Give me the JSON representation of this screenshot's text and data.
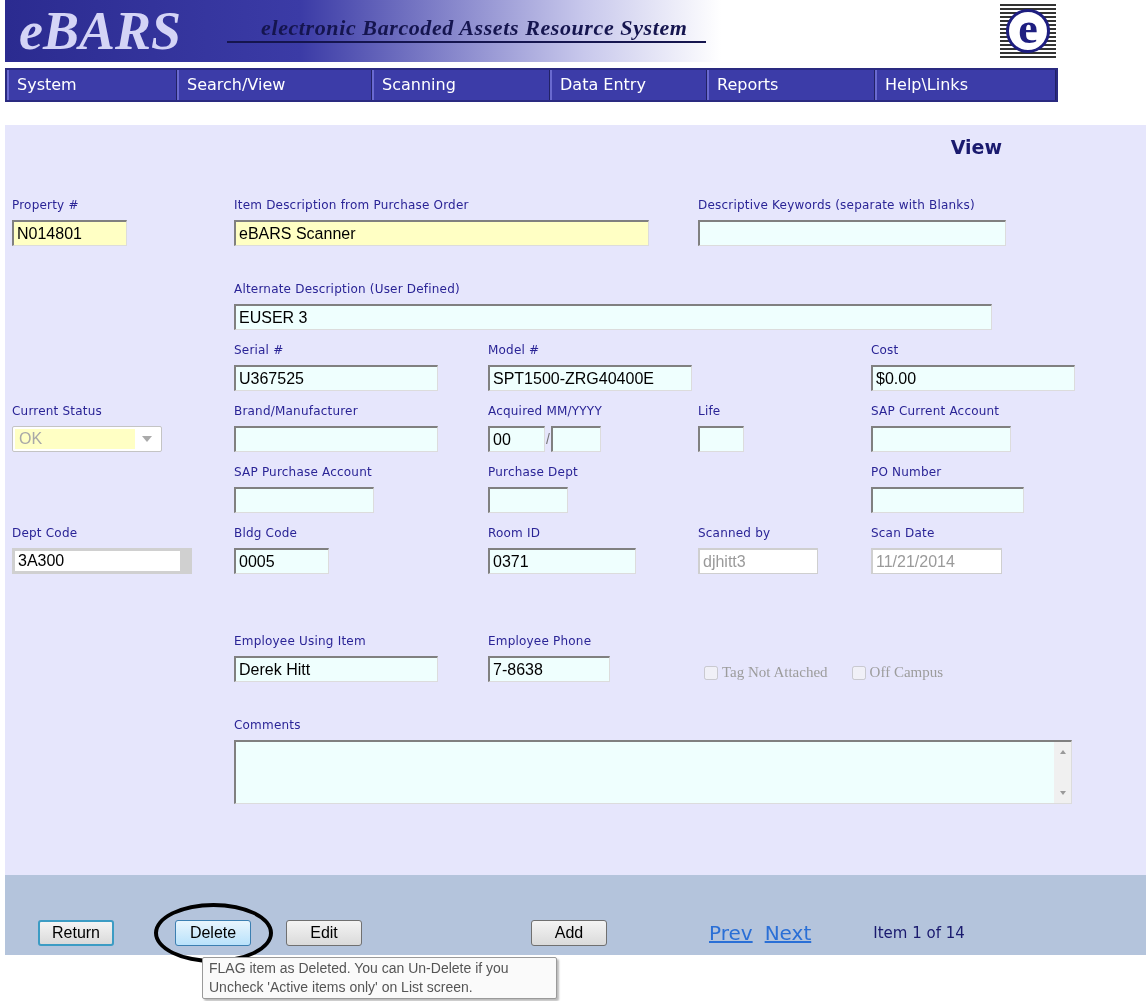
{
  "header": {
    "logo": "eBARS",
    "tagline": "electronic Barcoded Assets Resource System",
    "emblem": "e"
  },
  "nav": [
    {
      "label": "System"
    },
    {
      "label": "Search/View"
    },
    {
      "label": "Scanning"
    },
    {
      "label": "Data Entry"
    },
    {
      "label": "Reports"
    },
    {
      "label": "Help\\Links"
    }
  ],
  "page_title": "View",
  "form_rows": [
    [
      {
        "kind": "text",
        "label": "Property #",
        "value": "N014801",
        "color": "#ffffc4"
      },
      {
        "kind": "text",
        "label": "Item Description from Purchase Order",
        "value": "eBARS Scanner",
        "color": "#ffffc4"
      },
      null,
      {
        "kind": "text",
        "label": "Descriptive Keywords (separate with Blanks)",
        "color": "#effffe"
      },
      null
    ],
    [
      null,
      {
        "kind": "text",
        "label": "Alternate Description (User Defined)",
        "value": "EUSER 3",
        "color": "#effffe"
      },
      null,
      null,
      null
    ],
    [
      null,
      {
        "kind": "text",
        "label": "Serial #",
        "value": "U367525",
        "color": "#effffe"
      },
      {
        "kind": "text",
        "label": "Model #",
        "value": "SPT1500-ZRG40400E",
        "color": "#effffe"
      },
      null,
      {
        "kind": "text",
        "label": "Cost",
        "value": "$0.00",
        "color": "#effffe"
      }
    ],
    [
      {
        "kind": "select",
        "label": "Current Status",
        "value": "OK",
        "color": "#ffffc4",
        "disabled": true
      },
      {
        "kind": "text",
        "label": "Brand/Manufacturer",
        "color": "#effffe"
      },
      {
        "kind": "date",
        "label": "Acquired MM/YYYY",
        "month": "00",
        "separator": "/",
        "color": "#effffe"
      },
      {
        "kind": "text",
        "label": "Life",
        "color": "#effffe"
      },
      {
        "kind": "text",
        "label": "SAP Current Account",
        "color": "#effffe"
      }
    ],
    [
      null,
      {
        "kind": "text",
        "label": "SAP Purchase Account",
        "color": "#effffe"
      },
      {
        "kind": "text",
        "label": "Purchase Dept",
        "color": "#effffe"
      },
      null,
      {
        "kind": "text",
        "label": "PO Number",
        "color": "#effffe"
      }
    ],
    [
      {
        "kind": "text",
        "label": "Dept Code",
        "value": "3A300",
        "color": "#ffffff"
      },
      {
        "kind": "text",
        "label": "Bldg Code",
        "value": "0005",
        "color": "#effffe"
      },
      {
        "kind": "text",
        "label": "Room ID",
        "value": "0371",
        "color": "#effffe"
      },
      {
        "kind": "text",
        "label": "Scanned by",
        "value": "djhitt3",
        "color": "#ffffff",
        "disabled": true
      },
      {
        "kind": "text",
        "label": "Scan Date",
        "value": "11/21/2014",
        "color": "#ffffff",
        "disabled": true
      }
    ],
    [
      null,
      {
        "kind": "text",
        "label": "Employee Using Item",
        "value": "Derek Hitt",
        "color": "#effffe"
      },
      {
        "kind": "text",
        "label": "Employee Phone",
        "value": "7-8638",
        "color": "#effffe"
      },
      {
        "kind": "checkboxes",
        "items": [
          {
            "label": "Tag Not Attached",
            "checked": false,
            "disabled": true
          },
          {
            "label": "Off Campus",
            "checked": false,
            "disabled": true
          }
        ]
      },
      null
    ],
    [
      null,
      {
        "kind": "textarea",
        "label": "Comments",
        "color": "#effffe"
      },
      null,
      null,
      null
    ]
  ],
  "footer": {
    "buttons": [
      {
        "label": "Return",
        "default": true,
        "highlighted": false
      },
      {
        "label": "Delete",
        "default": false,
        "highlighted": true,
        "circled": true
      },
      {
        "label": "Edit",
        "default": false,
        "highlighted": false
      },
      {
        "label": "Add",
        "default": false,
        "highlighted": false
      }
    ],
    "links": [
      {
        "label": "Prev"
      },
      {
        "label": "Next"
      }
    ],
    "counter": "Item 1 of 14"
  },
  "tooltip": {
    "lines": [
      "FLAG item as Deleted.  You can Un-Delete if you",
      "Uncheck 'Active items only' on List screen."
    ]
  }
}
